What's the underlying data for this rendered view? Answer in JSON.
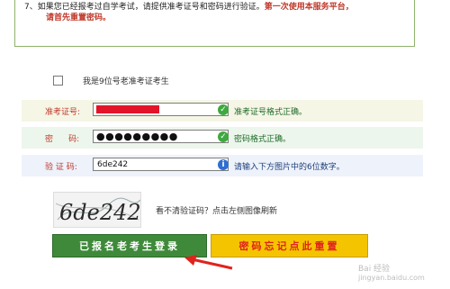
{
  "notice": {
    "line1_prefix": "7、如果您已经报考过自学考试，请提供准考证号和密码进行验证。",
    "line1_bold": "第一次使用本服务平台，",
    "line2": "请首先重置密码。"
  },
  "checkbox": {
    "label": "我是9位号老准考证考生"
  },
  "fields": {
    "exam_id": {
      "label": "准考证号:",
      "status": "准考证号格式正确。"
    },
    "password": {
      "label": "密      码:",
      "value": "●●●●●●●●●",
      "status": "密码格式正确。"
    },
    "captcha": {
      "label": "验 证 码:",
      "value": "6de242",
      "status": "请输入下方图片中的6位数字。"
    }
  },
  "captcha_image": {
    "text": "6de242",
    "hint": "看不清验证码？点击左侧图像刷新"
  },
  "buttons": {
    "login": "已报名老考生登录",
    "reset": "密码忘记点此重置"
  },
  "watermark": {
    "brand": "Bai 经验",
    "url": "jingyan.baidu.com"
  },
  "colors": {
    "login_button": "#3f8a3a",
    "reset_button": "#f5c400",
    "label_red": "#c0392b",
    "ok_icon": "#3fa93f",
    "info_icon": "#2f6fd1",
    "arrow": "#e0231c"
  }
}
